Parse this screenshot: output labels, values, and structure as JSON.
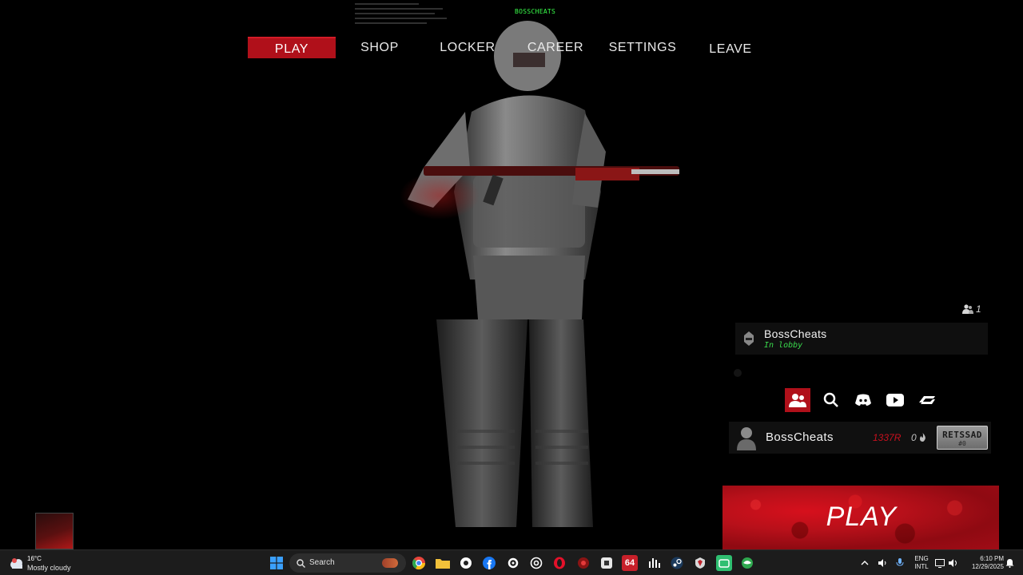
{
  "overlay": {
    "top_tag": "BOSSCHEATS"
  },
  "nav": {
    "items": [
      {
        "label": "PLAY",
        "active": true
      },
      {
        "label": "SHOP",
        "active": false
      },
      {
        "label": "LOCKER",
        "active": false
      },
      {
        "label": "CAREER",
        "active": false
      },
      {
        "label": "SETTINGS",
        "active": false
      },
      {
        "label": "LEAVE",
        "active": false
      }
    ]
  },
  "lobby": {
    "count": "1",
    "member": {
      "name": "BossCheats",
      "status": "In lobby"
    }
  },
  "social": {
    "icons": [
      "friends-icon",
      "search-icon",
      "discord-icon",
      "youtube-icon",
      "logo-icon"
    ]
  },
  "profile": {
    "name": "BossCheats",
    "currency": "1337R",
    "secondary": "0",
    "badge_text": "RETSSAD",
    "badge_sub": "#0"
  },
  "play_button": {
    "label": "PLAY"
  },
  "taskbar": {
    "weather_temp": "16°C",
    "weather_desc": "Mostly cloudy",
    "search_label": "Search",
    "language": "ENG",
    "language_sub": "INTL",
    "time": "6:10 PM",
    "date": "12/29/2025",
    "pinned_badge": "64"
  },
  "colors": {
    "accent": "#b0101a",
    "status_online": "#39d84c",
    "tag_green": "#39ff4a"
  }
}
